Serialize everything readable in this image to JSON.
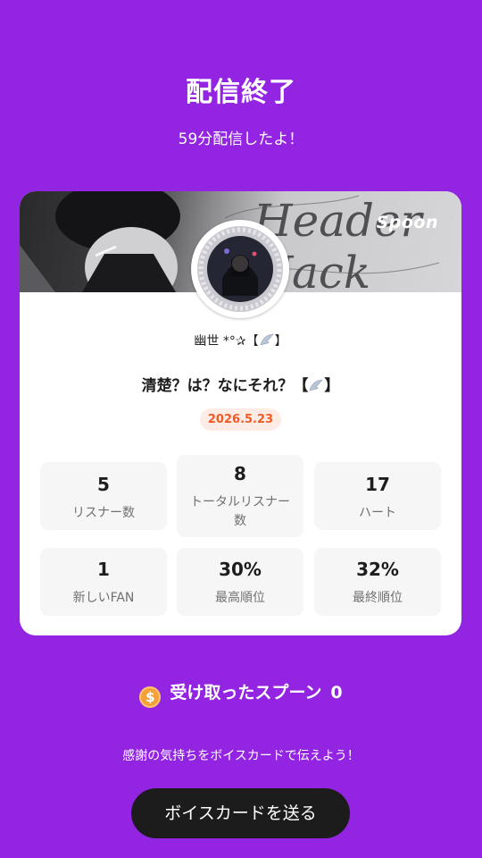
{
  "header": {
    "title": "配信終了",
    "subtitle": "59分配信したよ！"
  },
  "card": {
    "banner_brand": "Spoon",
    "dj_name": "幽世 *°✰【",
    "dj_name_suffix": "】",
    "live_title": "清楚？は？なにそれ？【",
    "live_title_suffix": "】",
    "date": "2026.5.23",
    "stats": [
      {
        "value": "5",
        "label": "リスナー数"
      },
      {
        "value": "8",
        "label": "トータルリスナー数"
      },
      {
        "value": "17",
        "label": "ハート"
      },
      {
        "value": "1",
        "label": "新しいFAN"
      },
      {
        "value": "30%",
        "label": "最高順位"
      },
      {
        "value": "32%",
        "label": "最終順位"
      }
    ]
  },
  "spoons": {
    "coin_symbol": "$",
    "label": "受け取ったスプーン",
    "amount": "0"
  },
  "footer": {
    "thanks_text": "感謝の気持ちをボイスカードで伝えよう！",
    "button_label": "ボイスカードを送る"
  },
  "colors": {
    "background": "#9224E2",
    "card": "#FFFFFF",
    "date_text": "#F15A24",
    "date_bg": "#FDECE5",
    "button": "#1C1C1C"
  }
}
